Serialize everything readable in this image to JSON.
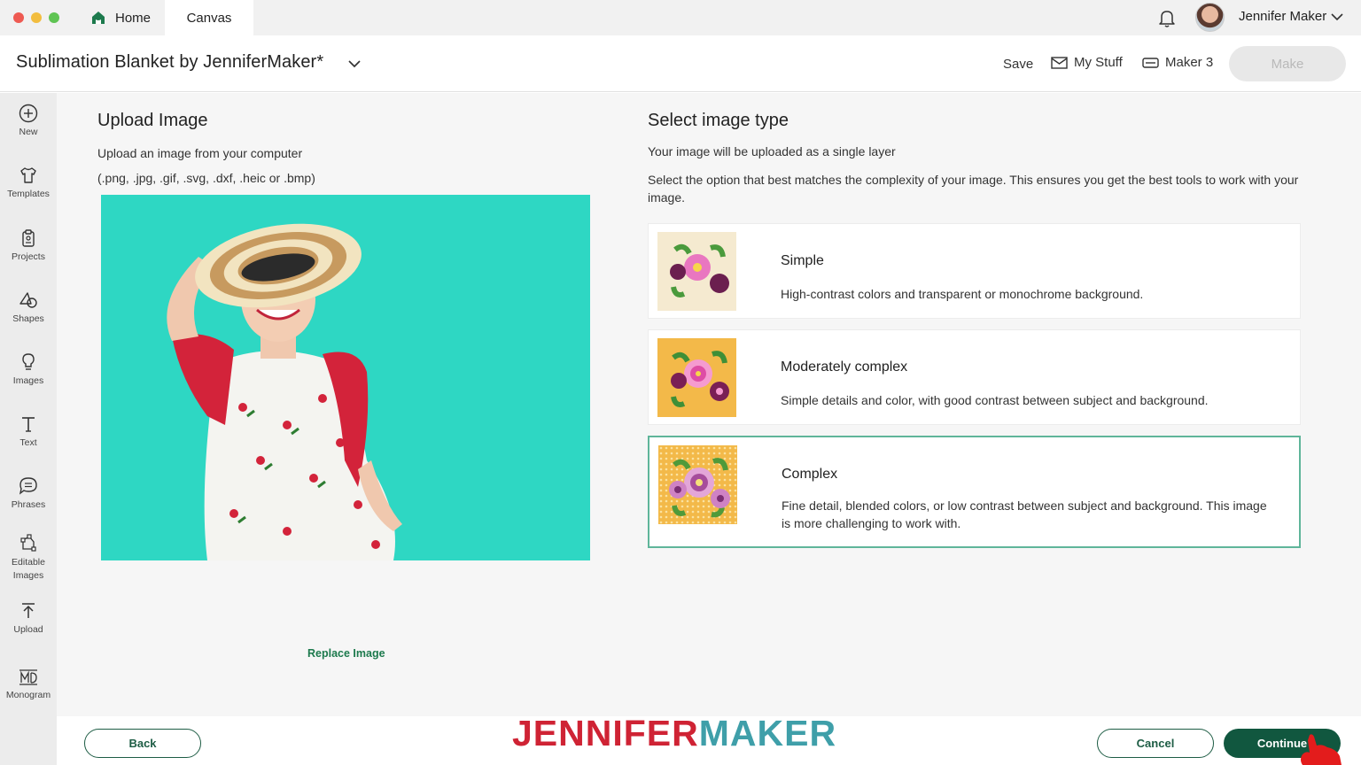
{
  "window": {
    "tabs": [
      {
        "label": "Home"
      },
      {
        "label": "Canvas"
      }
    ],
    "user_name": "Jennifer Maker"
  },
  "header": {
    "project_title": "Sublimation Blanket by JenniferMaker*",
    "save_label": "Save",
    "mystuff_label": "My Stuff",
    "machine_label": "Maker 3",
    "make_label": "Make"
  },
  "sidebar": {
    "items": [
      {
        "label": "New",
        "icon": "plus-circle-icon"
      },
      {
        "label": "Templates",
        "icon": "shirt-icon"
      },
      {
        "label": "Projects",
        "icon": "clipboard-icon"
      },
      {
        "label": "Shapes",
        "icon": "shapes-icon"
      },
      {
        "label": "Images",
        "icon": "lightbulb-icon"
      },
      {
        "label": "Text",
        "icon": "text-icon"
      },
      {
        "label": "Phrases",
        "icon": "speech-bubble-icon"
      },
      {
        "label": "Editable Images",
        "icon": "editable-image-icon"
      },
      {
        "label": "Upload",
        "icon": "upload-icon"
      },
      {
        "label": "Monogram",
        "icon": "monogram-icon"
      }
    ]
  },
  "upload": {
    "title": "Upload Image",
    "description": "Upload an image from your computer",
    "formats": "(.png, .jpg, .gif, .svg, .dxf, .heic or .bmp)",
    "replace_label": "Replace Image"
  },
  "image_type": {
    "title": "Select image type",
    "desc1": "Your image will be uploaded as a single layer",
    "desc2": "Select the option that best matches the complexity of your image. This ensures you get the best tools to work with your image.",
    "options": [
      {
        "title": "Simple",
        "description": "High-contrast colors and transparent or monochrome background.",
        "selected": false
      },
      {
        "title": "Moderately complex",
        "description": "Simple details and color, with good contrast between subject and background.",
        "selected": false
      },
      {
        "title": "Complex",
        "description": "Fine detail, blended colors, or low contrast between subject and background. This image is more challenging to work with.",
        "selected": true
      }
    ]
  },
  "footer": {
    "back_label": "Back",
    "logo_part1": "JENNIFER",
    "logo_part2": "MAKER",
    "cancel_label": "Cancel",
    "continue_label": "Continue"
  },
  "colors": {
    "brand_green": "#11573f",
    "selected_border": "#5fb59a",
    "photo_bg": "#2dd6c1",
    "logo_red": "#cf2334",
    "logo_teal": "#3f9fa9"
  }
}
